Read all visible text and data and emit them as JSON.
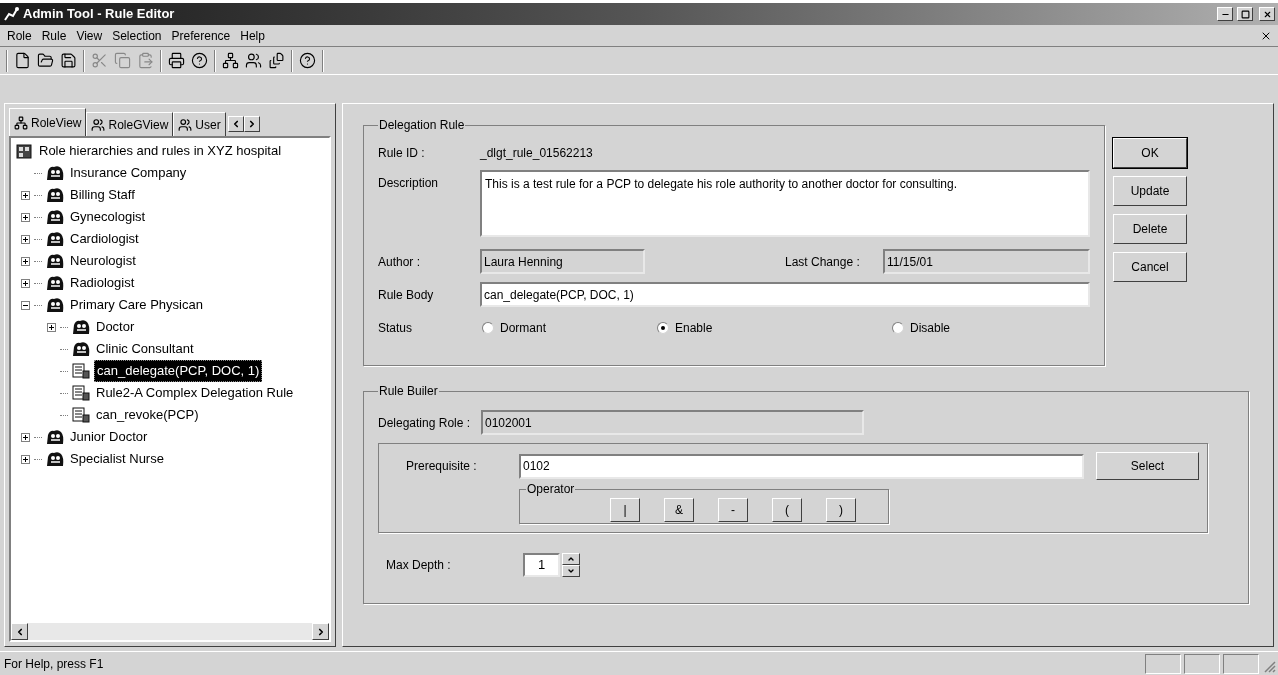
{
  "window": {
    "title": "Admin Tool - Rule Editor"
  },
  "menu": [
    "Role",
    "Rule",
    "View",
    "Selection",
    "Preference",
    "Help"
  ],
  "left_panel": {
    "tabs": [
      {
        "label": "RoleView",
        "kind": "tree",
        "selected": true
      },
      {
        "label": "RoleGView",
        "kind": "graph",
        "selected": false
      },
      {
        "label": "User",
        "kind": "user",
        "selected": false
      }
    ],
    "tree": {
      "label": "Role hierarchies and rules in XYZ hospital",
      "kind": "root",
      "selected": false,
      "children": [
        {
          "label": "Insurance Company",
          "kind": "role",
          "collapsible": false,
          "selected": false
        },
        {
          "label": "Billing Staff",
          "kind": "role",
          "collapsible": true,
          "expanded": false,
          "selected": false
        },
        {
          "label": "Gynecologist",
          "kind": "role",
          "collapsible": true,
          "expanded": false,
          "selected": false
        },
        {
          "label": "Cardiologist",
          "kind": "role",
          "collapsible": true,
          "expanded": false,
          "selected": false
        },
        {
          "label": "Neurologist",
          "kind": "role",
          "collapsible": true,
          "expanded": false,
          "selected": false
        },
        {
          "label": "Radiologist",
          "kind": "role",
          "collapsible": true,
          "expanded": false,
          "selected": false
        },
        {
          "label": "Primary Care Physican",
          "kind": "role",
          "collapsible": true,
          "expanded": true,
          "selected": false,
          "children": [
            {
              "label": "Doctor",
              "kind": "role",
              "collapsible": true,
              "expanded": false,
              "selected": false
            },
            {
              "label": "Clinic Consultant",
              "kind": "role",
              "collapsible": false,
              "selected": false
            },
            {
              "label": "can_delegate(PCP, DOC, 1)",
              "kind": "rule",
              "collapsible": false,
              "selected": true
            },
            {
              "label": "Rule2-A Complex Delegation Rule",
              "kind": "rule",
              "collapsible": false,
              "selected": false
            },
            {
              "label": "can_revoke(PCP)",
              "kind": "rule",
              "collapsible": false,
              "selected": false
            }
          ]
        },
        {
          "label": "Junior Doctor",
          "kind": "role",
          "collapsible": true,
          "expanded": false,
          "selected": false
        },
        {
          "label": "Specialist Nurse",
          "kind": "role",
          "collapsible": true,
          "expanded": false,
          "selected": false
        }
      ]
    }
  },
  "delegation_rule": {
    "title": "Delegation Rule",
    "rule_id": {
      "label": "Rule ID :",
      "value": "_dlgt_rule_01562213"
    },
    "description": {
      "label": "Description",
      "value": "This is a test rule for a PCP to delegate his role authority to another doctor for consulting."
    },
    "author": {
      "label": "Author :",
      "value": "Laura Henning",
      "readonly": true
    },
    "last_change": {
      "label": "Last Change :",
      "value": "11/15/01",
      "readonly": true
    },
    "rule_body": {
      "label": "Rule Body",
      "value": "can_delegate(PCP, DOC, 1)",
      "readonly": false
    },
    "status": {
      "label": "Status",
      "options": [
        {
          "label": "Dormant",
          "selected": false
        },
        {
          "label": "Enable",
          "selected": true
        },
        {
          "label": "Disable",
          "selected": false
        }
      ]
    }
  },
  "buttons": [
    {
      "label": "OK",
      "default": true
    },
    {
      "label": "Update",
      "default": false
    },
    {
      "label": "Delete",
      "default": false
    },
    {
      "label": "Cancel",
      "default": false
    }
  ],
  "rule_builder": {
    "title": "Rule Builer",
    "delegating_role": {
      "label": "Delegating Role :",
      "value": "0102001",
      "readonly": true
    },
    "prerequisite": {
      "label": "Prerequisite :",
      "value": "0102",
      "readonly": false
    },
    "select_button": "Select",
    "operator": {
      "title": "Operator",
      "buttons": [
        "|",
        "&",
        "-",
        "(",
        ")"
      ]
    },
    "max_depth": {
      "label": "Max Depth :",
      "value": "1"
    }
  },
  "status_bar": {
    "text": "For Help, press F1"
  }
}
